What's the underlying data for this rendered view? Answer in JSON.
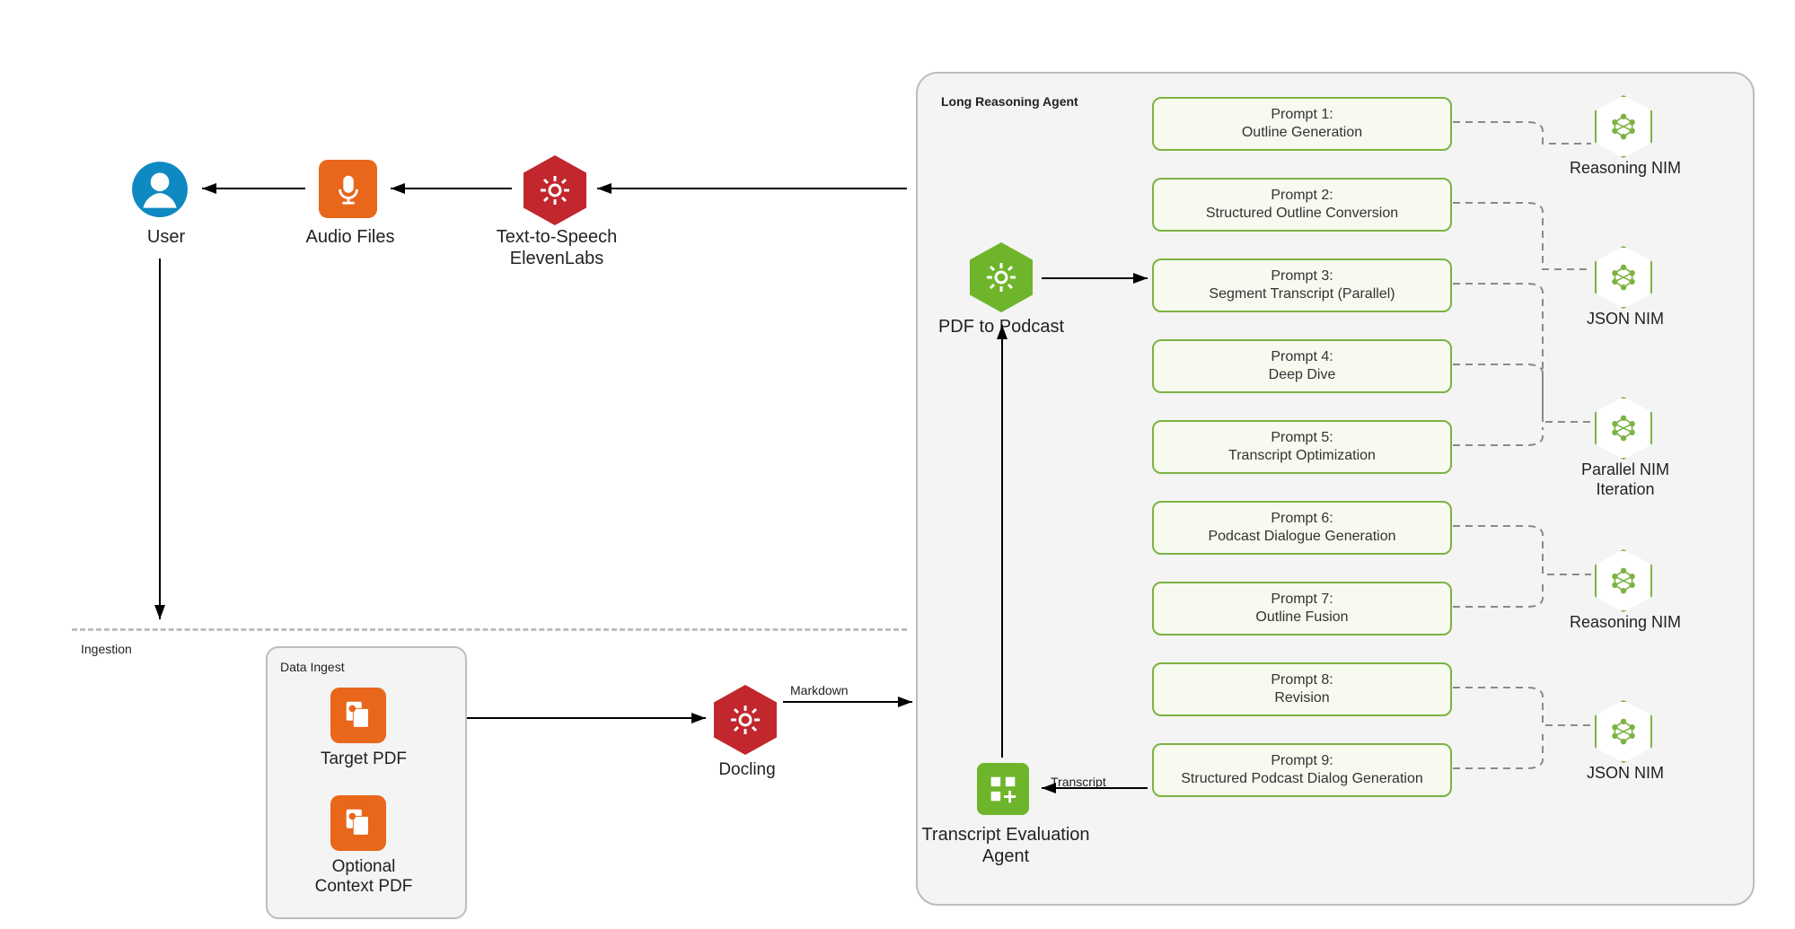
{
  "nodes": {
    "user": "User",
    "audio": "Audio Files",
    "tts_l1": "Text-to-Speech",
    "tts_l2": "ElevenLabs",
    "pdf2podcast": "PDF to Podcast",
    "docling": "Docling",
    "markdown": "Markdown",
    "transcript": "Transcript",
    "tea_l1": "Transcript Evaluation",
    "tea_l2": "Agent",
    "target_pdf": "Target PDF",
    "opt_l1": "Optional",
    "opt_l2": "Context PDF"
  },
  "sections": {
    "ingestion": "Ingestion",
    "data_ingest": "Data Ingest",
    "long_reasoning": "Long Reasoning Agent"
  },
  "prompts": [
    {
      "n": "Prompt 1:",
      "d": "Outline Generation"
    },
    {
      "n": "Prompt 2:",
      "d": "Structured Outline Conversion"
    },
    {
      "n": "Prompt 3:",
      "d": "Segment Transcript (Parallel)"
    },
    {
      "n": "Prompt 4:",
      "d": "Deep Dive"
    },
    {
      "n": "Prompt 5:",
      "d": "Transcript Optimization"
    },
    {
      "n": "Prompt 6:",
      "d": "Podcast Dialogue Generation"
    },
    {
      "n": "Prompt 7:",
      "d": "Outline Fusion"
    },
    {
      "n": "Prompt 8:",
      "d": "Revision"
    },
    {
      "n": "Prompt 9:",
      "d": "Structured Podcast Dialog Generation"
    }
  ],
  "nims": {
    "reasoning": "Reasoning NIM",
    "json": "JSON NIM",
    "parallel_l1": "Parallel NIM",
    "parallel_l2": "Iteration"
  }
}
